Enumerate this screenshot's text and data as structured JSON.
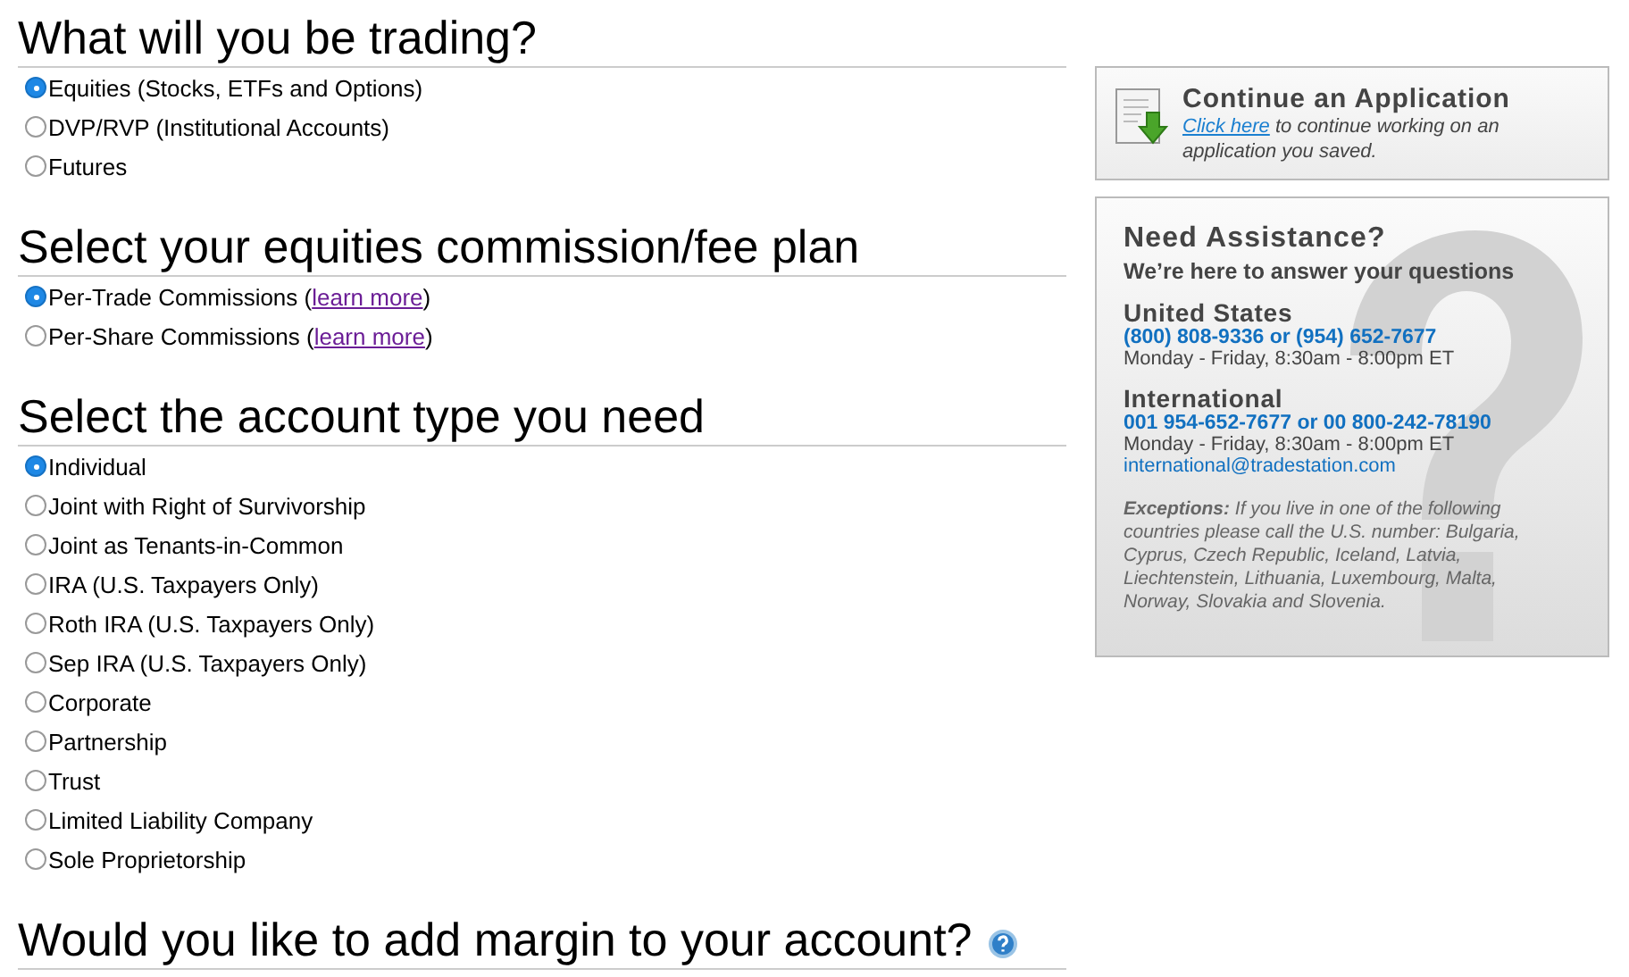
{
  "sections": [
    {
      "title": "What will you be trading?",
      "options": [
        {
          "label": "Equities (Stocks, ETFs and Options)",
          "selected": true
        },
        {
          "label": "DVP/RVP (Institutional Accounts)",
          "selected": false
        },
        {
          "label": "Futures",
          "selected": false
        }
      ]
    },
    {
      "title": "Select your equities commission/fee plan",
      "options": [
        {
          "label": "Per-Trade Commissions (",
          "link": "learn more",
          "after": ")",
          "selected": true
        },
        {
          "label": "Per-Share Commissions (",
          "link": "learn more",
          "after": ")",
          "selected": false
        }
      ]
    },
    {
      "title": "Select the account type you need",
      "options": [
        {
          "label": "Individual",
          "selected": true
        },
        {
          "label": "Joint with Right of Survivorship",
          "selected": false
        },
        {
          "label": "Joint as Tenants-in-Common",
          "selected": false
        },
        {
          "label": "IRA (U.S. Taxpayers Only)",
          "selected": false
        },
        {
          "label": "Roth IRA (U.S. Taxpayers Only)",
          "selected": false
        },
        {
          "label": "Sep IRA (U.S. Taxpayers Only)",
          "selected": false
        },
        {
          "label": "Corporate",
          "selected": false
        },
        {
          "label": "Partnership",
          "selected": false
        },
        {
          "label": "Trust",
          "selected": false
        },
        {
          "label": "Limited Liability Company",
          "selected": false
        },
        {
          "label": "Sole Proprietorship",
          "selected": false
        }
      ]
    },
    {
      "title": "Would you like to add margin to your account?",
      "help": true
    }
  ],
  "continue_box": {
    "title": "Continue an Application",
    "link": "Click here",
    "text": "to continue working on an application you saved."
  },
  "assistance": {
    "title": "Need Assistance?",
    "subtitle": "We’re here to answer your questions",
    "regions": [
      {
        "name": "United States",
        "phone": "(800) 808-9336 or (954) 652-7677",
        "hours": "Monday - Friday, 8:30am - 8:00pm ET"
      },
      {
        "name": "International",
        "phone": "001 954-652-7677 or 00 800-242-78190",
        "hours": "Monday - Friday, 8:30am - 8:00pm ET",
        "email": "international@tradestation.com"
      }
    ],
    "exceptions": "**Exceptions:** If you live in one of the following countries please call the U.S. number: Bulgaria, Cyprus, Czech Republic, Iceland, Latvia, Liechtenstein, Lithuania, Luxembourg, Malta, Norway, Slovakia and Slovenia."
  }
}
